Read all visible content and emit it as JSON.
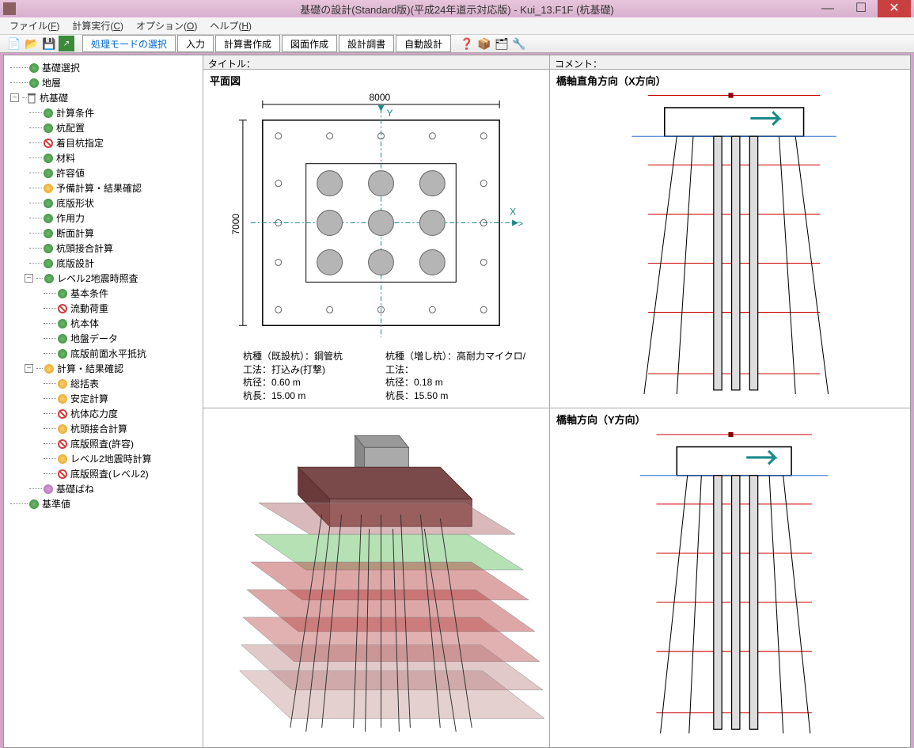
{
  "title": "基礎の設計(Standard版)(平成24年道示対応版) - Kui_13.F1F (杭基礎)",
  "menu": {
    "file": "ファイル(",
    "file_u": "F",
    "file2": ")",
    "calc": "計算実行(",
    "calc_u": "C",
    "calc2": ")",
    "opt": "オプション(",
    "opt_u": "O",
    "opt2": ")",
    "help": "ヘルプ(",
    "help_u": "H",
    "help2": ")"
  },
  "toolbar": {
    "mode": "処理モードの選択",
    "b1": "入力",
    "b2": "計算書作成",
    "b3": "図面作成",
    "b4": "設計調書",
    "b5": "自動設計"
  },
  "header": {
    "left": "タイトル：",
    "right": "コメント："
  },
  "tree": {
    "n1": "基礎選択",
    "n2": "地層",
    "n3": "杭基礎",
    "n4": "計算条件",
    "n5": "杭配置",
    "n6": "着目杭指定",
    "n7": "材料",
    "n8": "許容値",
    "n9": "予備計算・結果確認",
    "n10": "底版形状",
    "n11": "作用力",
    "n12": "断面計算",
    "n13": "杭頭接合計算",
    "n14": "底版設計",
    "n15": "レベル2地震時照査",
    "n16": "基本条件",
    "n17": "流動荷重",
    "n18": "杭本体",
    "n19": "地盤データ",
    "n20": "底版前面水平抵抗",
    "n21": "計算・結果確認",
    "n22": "総括表",
    "n23": "安定計算",
    "n24": "杭体応力度",
    "n25": "杭頭接合計算",
    "n26": "底版照査(許容)",
    "n27": "レベル2地震時計算",
    "n28": "底版照査(レベル2)",
    "n29": "基礎ばね",
    "n30": "基準値"
  },
  "plan": {
    "title": "平面図",
    "w": "8000",
    "h": "7000",
    "l1": "杭種（既設杭）：鋼管杭",
    "l2": "工法：打込み(打撃)",
    "l3": "杭径：0.60 m",
    "l4": "杭長：15.00 m",
    "r1": "杭種（増し杭）：高耐力マイクロ/",
    "r2": "工法：",
    "r3": "杭径：0.18 m",
    "r4": "杭長：15.50 m"
  },
  "elev1": {
    "title": "橋軸直角方向（X方向）"
  },
  "elev2": {
    "title": "橋軸方向（Y方向）"
  }
}
